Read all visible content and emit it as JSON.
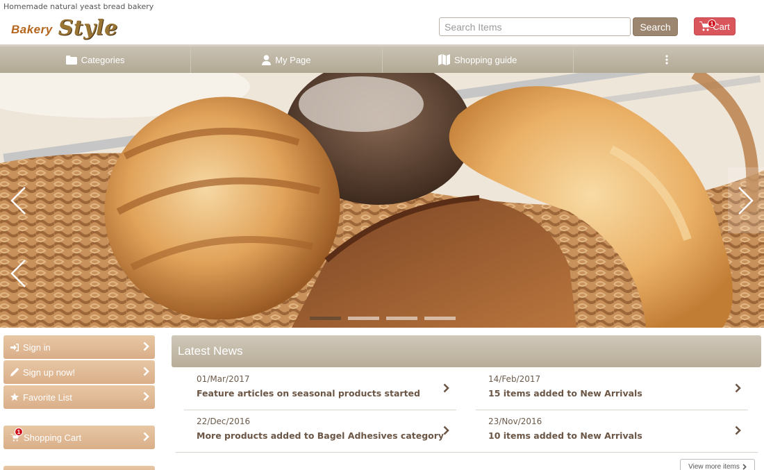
{
  "header": {
    "tagline": "Homemade natural yeast bread bakery",
    "logo_word1": "Bakery",
    "logo_word2": "Style",
    "search_placeholder": "Search Items",
    "search_label": "Search",
    "cart_label": "Cart",
    "cart_count": "1"
  },
  "nav": {
    "items": [
      {
        "label": "Categories",
        "icon": "folder-icon"
      },
      {
        "label": "My Page",
        "icon": "user-icon"
      },
      {
        "label": "Shopping guide",
        "icon": "map-icon"
      },
      {
        "label": "",
        "icon": "more-vertical-icon"
      }
    ]
  },
  "slider": {
    "slide_count": 4,
    "active_index": 0
  },
  "sidebar": {
    "items": [
      {
        "label": "Sign in",
        "icon": "sign-in-icon"
      },
      {
        "label": "Sign up now!",
        "icon": "pencil-icon"
      },
      {
        "label": "Favorite List",
        "icon": "star-icon"
      },
      {
        "label": "Shopping Cart",
        "icon": "cart-icon",
        "badge": "1"
      }
    ]
  },
  "news": {
    "title": "Latest News",
    "items": [
      {
        "date": "01/Mar/2017",
        "title": "Feature articles on seasonal products started"
      },
      {
        "date": "14/Feb/2017",
        "title": "15 items added to New Arrivals"
      },
      {
        "date": "22/Dec/2016",
        "title": "More products added to Bagel Adhesives category"
      },
      {
        "date": "23/Nov/2016",
        "title": "10 items added to New Arrivals"
      }
    ],
    "view_more": "View more items"
  },
  "colors": {
    "accent": "#9c8670",
    "cart": "#d9565d",
    "sidebar_button": "#dcb38e",
    "nav": "#bdb4a1"
  }
}
